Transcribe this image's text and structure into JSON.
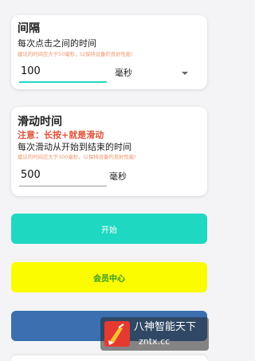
{
  "interval_card": {
    "title": "间隔",
    "subtitle": "每次点击之间的时间",
    "tip": "建议的时间应大于50毫秒，以保持设备的良好性能!",
    "input_value": "100",
    "unit": "毫秒"
  },
  "swipe_card": {
    "title": "滑动时间",
    "warning": "注意：长按+就是滑动",
    "subtitle": "每次滑动从开始到结束的时间",
    "tip": "建议的时间应大于300毫秒，以保持设备的良好性能!",
    "input_value": "500",
    "unit": "毫秒"
  },
  "buttons": {
    "start": "开始",
    "vip": "会员中心",
    "video": "视"
  },
  "watermark": {
    "title": "八神智能天下",
    "url": "zntx.cc"
  },
  "colors": {
    "accent": "#1fd8c2",
    "vip": "#fcfc00",
    "vip_text": "#2f9a2a",
    "video": "#3b6fb0",
    "tip": "#f0946a",
    "warning": "#e0533a"
  }
}
